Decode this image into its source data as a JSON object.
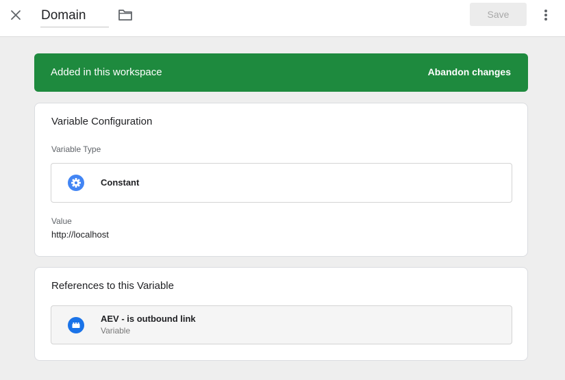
{
  "header": {
    "name": "Domain",
    "save_label": "Save"
  },
  "banner": {
    "text": "Added in this workspace",
    "action": "Abandon changes",
    "color": "#1e8a3e"
  },
  "config": {
    "title": "Variable Configuration",
    "type_label": "Variable Type",
    "type_name": "Constant",
    "type_icon": "gear-icon",
    "value_label": "Value",
    "value": "http://localhost"
  },
  "references": {
    "title": "References to this Variable",
    "items": [
      {
        "name": "AEV - is outbound link",
        "kind": "Variable",
        "icon": "variable-block-icon"
      }
    ]
  },
  "colors": {
    "accent_blue": "#4285f4",
    "reference_blue": "#1a73e8"
  }
}
